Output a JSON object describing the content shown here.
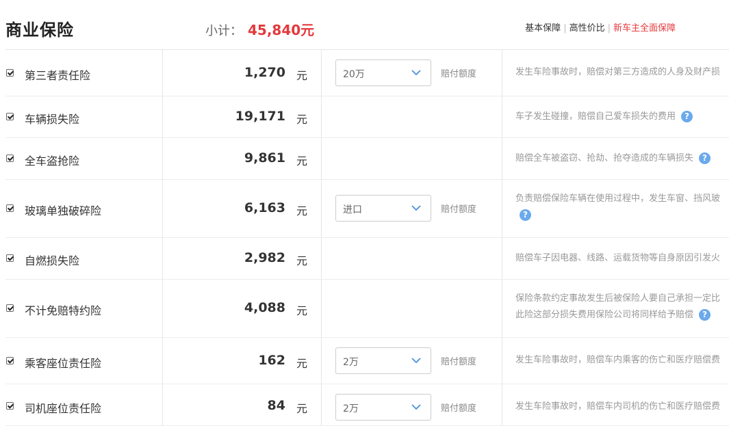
{
  "header": {
    "title": "商业保险",
    "subtotal_label": "小计：",
    "subtotal_value": "45,840元",
    "plans": [
      "基本保障",
      "高性价比",
      "新车主全面保障"
    ]
  },
  "rows": [
    {
      "name": "第三者责任险",
      "price": "1,270",
      "unit": "元",
      "option": "20万",
      "option_label": "赔付额度",
      "desc": [
        "发生车险事故时，赔偿对第三方造成的人身及财产损"
      ],
      "help": false
    },
    {
      "name": "车辆损失险",
      "price": "19,171",
      "unit": "元",
      "option": "",
      "option_label": "",
      "desc": [
        "车子发生碰撞，赔偿自己爱车损失的费用"
      ],
      "help": true
    },
    {
      "name": "全车盗抢险",
      "price": "9,861",
      "unit": "元",
      "option": "",
      "option_label": "",
      "desc": [
        "赔偿全车被盗窃、抢劫、抢夺造成的车辆损失"
      ],
      "help": true
    },
    {
      "name": "玻璃单独破碎险",
      "price": "6,163",
      "unit": "元",
      "option": "进口",
      "option_label": "赔付额度",
      "desc": [
        "负责赔偿保险车辆在使用过程中，发生车窗、挡风玻"
      ],
      "help": true
    },
    {
      "name": "自燃损失险",
      "price": "2,982",
      "unit": "元",
      "option": "",
      "option_label": "",
      "desc": [
        "赔偿车子因电器、线路、运载货物等自身原因引发火"
      ],
      "help": false
    },
    {
      "name": "不计免赔特约险",
      "price": "4,088",
      "unit": "元",
      "option": "",
      "option_label": "",
      "desc": [
        "保险条款约定事故发生后被保险人要自己承担一定比",
        "此险这部分损失费用保险公司将同样给予赔偿"
      ],
      "help": true
    },
    {
      "name": "乘客座位责任险",
      "price": "162",
      "unit": "元",
      "option": "2万",
      "option_label": "赔付额度",
      "desc": [
        "发生车险事故时，赔偿车内乘客的伤亡和医疗赔偿费"
      ],
      "help": false
    },
    {
      "name": "司机座位责任险",
      "price": "84",
      "unit": "元",
      "option": "2万",
      "option_label": "赔付额度",
      "desc": [
        "发生车险事故时，赔偿车内司机的伤亡和医疗赔偿费"
      ],
      "help": false
    }
  ],
  "colors": {
    "accent": "#e4393c",
    "help": "#6aa9ec",
    "chevron": "#4a90d9"
  },
  "icons": {
    "checkbox": "checkbox-checked-icon",
    "select": "chevron-down-icon",
    "help": "question-circle-icon"
  }
}
